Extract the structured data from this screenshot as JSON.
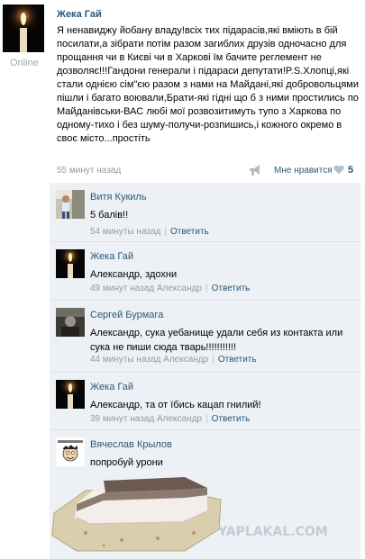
{
  "post": {
    "author": "Жека Гай",
    "status": "Online",
    "text": "Я ненавиджу йобану владу!всіх тих підарасів,які вміють в бій посилати,а зібрати потім разом загиблих друзів одночасно для прощання чи в Києві чи в Харкові їм бачите реглемент не дозволяє!!!Гандони генерали і підараси депутати!P.S.Хлопці,які стали однією сім\"єю разом з нами на Майдані,які добровольцями пішли і багато воювали,Брати-які гідні що б з ними простились по Майданівськи-ВАС любі мої розвозитимуть тупо з Харкова по одному-тихо і без шуму-получи-розпишись,і кожного окремо в своє місто...простіть",
    "time": "55 минут назад",
    "like_label": "Мне нравится",
    "like_count": "5"
  },
  "replies": [
    {
      "author": "Витя Кукиль",
      "text": "5 балів!!",
      "time": "54 минуты назад",
      "addressee": "",
      "reply_label": "Ответить"
    },
    {
      "author": "Жека Гай",
      "text": "Александр, здохни",
      "time": "49 минут назад",
      "addressee": "Александр",
      "reply_label": "Ответить"
    },
    {
      "author": "Сергей Бурмага",
      "text": "Александр, сука уебанище удали себя из контакта или сука не пиши сюда тварь!!!!!!!!!!!",
      "time": "44 минуты назад",
      "addressee": "Александр",
      "reply_label": "Ответить"
    },
    {
      "author": "Жека Гай",
      "text": "Александр, та от їбись кацап гнилий!",
      "time": "39 минут назад",
      "addressee": "Александр",
      "reply_label": "Ответить"
    },
    {
      "author": "Вячеслав Крылов",
      "text": "попробуй урони",
      "time": "",
      "addressee": "",
      "reply_label": ""
    }
  ],
  "watermark": "YAPLAKAL.COM",
  "colors": {
    "link": "#2b587a",
    "muted": "#999999",
    "reply_bg": "#edf1f5"
  },
  "icons": [
    "share-megaphone-icon",
    "heart-icon",
    "candle-avatar",
    "user-photo-avatar",
    "cartoon-avatar"
  ]
}
